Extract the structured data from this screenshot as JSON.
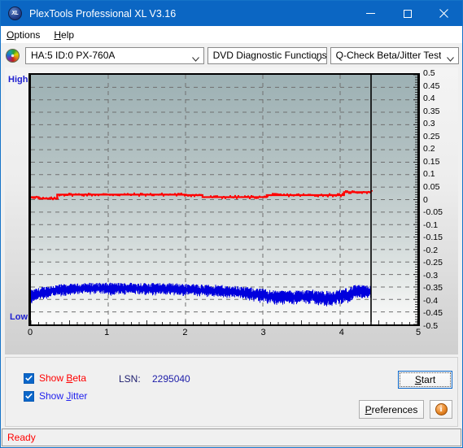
{
  "window": {
    "title": "PlexTools Professional XL V3.16",
    "icon": "XL",
    "minimize": "minimize-icon",
    "maximize": "maximize-icon",
    "close": "close-icon"
  },
  "menubar": {
    "items": [
      {
        "label": "Options",
        "accel": "O"
      },
      {
        "label": "Help",
        "accel": "H"
      }
    ]
  },
  "toolbar": {
    "drive_icon": "disc-icon",
    "drive": "HA:5 ID:0  PX-760A",
    "function": "DVD Diagnostic Functions",
    "test": "Q-Check Beta/Jitter Test"
  },
  "chart_data": {
    "type": "line",
    "title": "",
    "xlabel": "",
    "ylabel": "",
    "left_axis_labels": {
      "top": "High",
      "bottom": "Low"
    },
    "xticks": [
      0,
      1,
      2,
      3,
      4,
      5
    ],
    "xlim": [
      0,
      5
    ],
    "ylim": [
      -0.5,
      0.5
    ],
    "yticks": [
      0.5,
      0.45,
      0.4,
      0.35,
      0.3,
      0.25,
      0.2,
      0.15,
      0.1,
      0.05,
      0,
      -0.05,
      -0.1,
      -0.15,
      -0.2,
      -0.25,
      -0.3,
      -0.35,
      -0.4,
      -0.45,
      -0.5
    ],
    "grid": true,
    "grid_style": "dashed",
    "data_end_marker_x": 4.4,
    "legend": [
      "Show Beta",
      "Show Jitter"
    ],
    "series": [
      {
        "name": "Beta",
        "color": "#ff0000",
        "x": [
          0.0,
          0.1,
          0.2,
          0.3,
          0.34,
          0.4,
          0.6,
          0.8,
          1.0,
          1.2,
          1.4,
          1.6,
          1.8,
          2.0,
          2.1,
          2.2,
          2.22,
          2.4,
          2.6,
          2.8,
          3.0,
          3.05,
          3.2,
          3.4,
          3.6,
          3.8,
          4.0,
          4.05,
          4.2,
          4.4
        ],
        "y": [
          0.01,
          0.004,
          0.004,
          0.004,
          0.02,
          0.02,
          0.02,
          0.02,
          0.02,
          0.02,
          0.02,
          0.02,
          0.02,
          0.018,
          0.018,
          0.018,
          0.01,
          0.01,
          0.01,
          0.01,
          0.01,
          0.018,
          0.018,
          0.018,
          0.018,
          0.018,
          0.018,
          0.03,
          0.03,
          0.03
        ]
      },
      {
        "name": "Jitter",
        "color": "#0000dd",
        "band_center_x": [
          0.0,
          0.15,
          0.3,
          0.45,
          0.6,
          0.75,
          0.9,
          1.05,
          1.2,
          1.35,
          1.5,
          1.65,
          1.8,
          1.95,
          2.1,
          2.25,
          2.4,
          2.55,
          2.7,
          2.85,
          3.0,
          3.15,
          3.3,
          3.45,
          3.6,
          3.75,
          3.9,
          4.05,
          4.2,
          4.35,
          4.4
        ],
        "band_center_y": [
          -0.39,
          -0.375,
          -0.365,
          -0.362,
          -0.358,
          -0.355,
          -0.355,
          -0.357,
          -0.357,
          -0.356,
          -0.357,
          -0.358,
          -0.358,
          -0.36,
          -0.362,
          -0.364,
          -0.365,
          -0.368,
          -0.372,
          -0.378,
          -0.385,
          -0.39,
          -0.392,
          -0.39,
          -0.388,
          -0.392,
          -0.398,
          -0.385,
          -0.37,
          -0.368,
          -0.372
        ],
        "band_halfwidth": [
          0.028,
          0.026,
          0.024,
          0.024,
          0.022,
          0.022,
          0.022,
          0.024,
          0.024,
          0.024,
          0.024,
          0.024,
          0.024,
          0.024,
          0.024,
          0.024,
          0.024,
          0.024,
          0.026,
          0.026,
          0.028,
          0.028,
          0.028,
          0.028,
          0.028,
          0.03,
          0.03,
          0.03,
          0.028,
          0.026,
          0.026
        ]
      }
    ]
  },
  "controls": {
    "show_beta": {
      "label_pre": "Show ",
      "accel": "B",
      "label_post": "eta",
      "checked": true
    },
    "show_jitter": {
      "label_pre": "Show ",
      "accel": "J",
      "label_post": "itter",
      "checked": true
    },
    "lsn_label": "LSN:",
    "lsn_value": "2295040",
    "start": {
      "pre": "",
      "accel": "S",
      "post": "tart"
    },
    "preferences": {
      "pre": "",
      "accel": "P",
      "post": "references"
    },
    "info": "i"
  },
  "statusbar": {
    "text": "Ready"
  }
}
